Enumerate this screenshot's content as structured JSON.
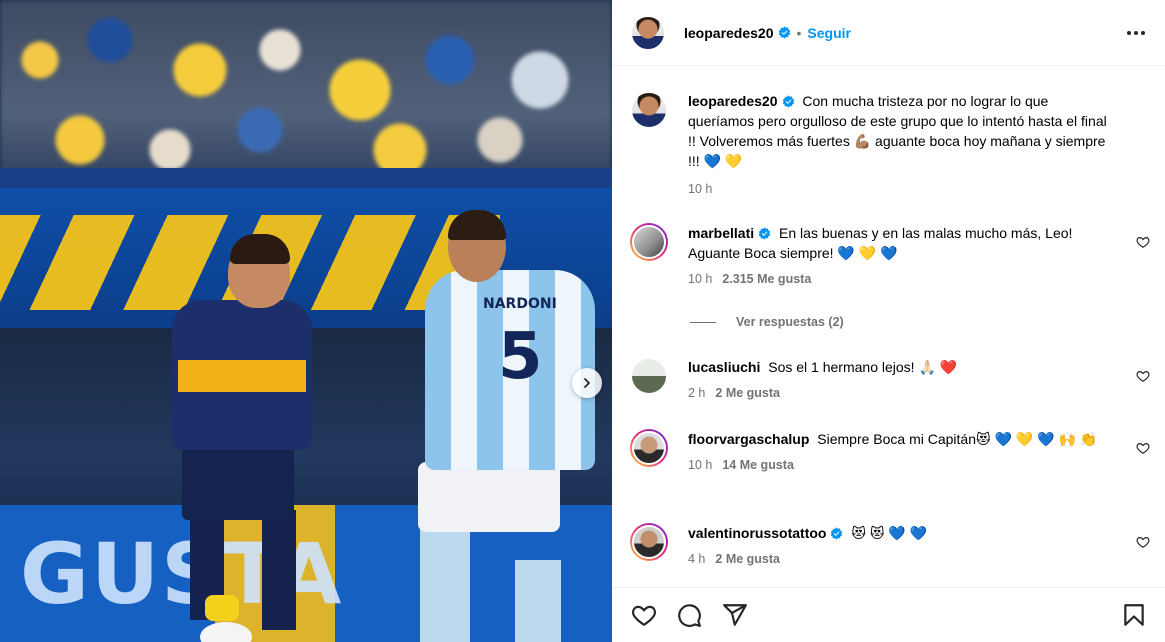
{
  "post": {
    "username": "leoparedes20",
    "follow_label": "Seguir",
    "caption": "Con mucha tristeza por no lograr lo que queríamos pero orgulloso de este grupo que lo intentó hasta el final !! Volveremos más fuertes 💪🏽 aguante boca hoy mañana y siempre !!! 💙 💛",
    "time": "10 h"
  },
  "photo": {
    "banner_text": "GUSTA",
    "player2_name": "NARDONI",
    "player2_number": "5"
  },
  "comments": [
    {
      "username": "marbellati",
      "verified": true,
      "text": "En las buenas y en las malas mucho más, Leo! Aguante Boca siempre! 💙 💛 💙",
      "time": "10 h",
      "likes": "2.315 Me gusta",
      "replies": "Ver respuestas (2)"
    },
    {
      "username": "lucasliuchi",
      "verified": false,
      "text": "Sos el 1 hermano lejos! 🙏🏻 ❤️",
      "time": "2 h",
      "likes": "2 Me gusta"
    },
    {
      "username": "floorvargaschalup",
      "verified": false,
      "text": "Siempre Boca mi Capitán😻 💙 💛 💙 🙌 👏",
      "time": "10 h",
      "likes": "14 Me gusta"
    },
    {
      "username": "valentinorussotattoo",
      "verified": true,
      "text": "😻 😻 💙 💙",
      "time": "4 h",
      "likes": "2 Me gusta"
    }
  ],
  "icons": {
    "verified": "verified-badge-icon",
    "more": "more-options-icon",
    "like": "heart-icon",
    "comment": "comment-icon",
    "share": "share-icon",
    "save": "bookmark-icon",
    "next": "chevron-right-icon"
  },
  "colors": {
    "accent": "#0095f6",
    "muted": "#737373",
    "verified": "#0095f6"
  }
}
